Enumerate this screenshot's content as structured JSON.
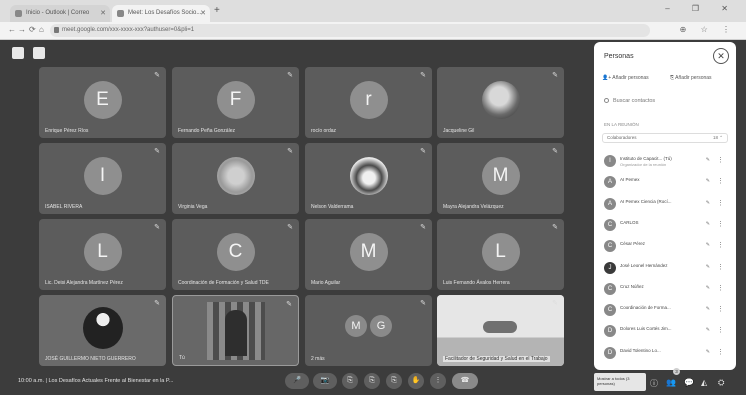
{
  "browser": {
    "tabs": [
      {
        "label": "Inicio - Outlook | Correo"
      },
      {
        "label": "Meet: Los Desafíos Socio..."
      }
    ],
    "new_tab": "+",
    "window_controls": "– ❐ ✕",
    "url": "meet.google.com/xxx-xxxx-xxx?authuser=0&pli=1",
    "nav": {
      "back": "←",
      "forward": "→",
      "reload": "⟳",
      "home": "⌂"
    },
    "addr_icons": "⊕ ☆ ⋮"
  },
  "tiles": [
    {
      "initial": "E",
      "name": "Enrique Pérez Ríos"
    },
    {
      "initial": "F",
      "name": "Fernando Peña González"
    },
    {
      "initial": "r",
      "name": "rocío ordaz"
    },
    {
      "initial": "",
      "name": "Jacqueline Gil",
      "photo": true
    },
    {
      "initial": "I",
      "name": "ISABEL RIVERA"
    },
    {
      "initial": "",
      "name": "Virginia Vega",
      "photo": true
    },
    {
      "initial": "",
      "name": "Nelson Valderrama",
      "photo": true
    },
    {
      "initial": "M",
      "name": "Mayra Alejandra Velázquez"
    },
    {
      "initial": "L",
      "name": "Lic. Deisi Alejandra Martínez Pérez"
    },
    {
      "initial": "C",
      "name": "Coordinación de Formación y Salud TDE"
    },
    {
      "initial": "M",
      "name": "Mario Aguilar"
    },
    {
      "initial": "L",
      "name": "Luis Fernando Ávalos Herrera"
    },
    {
      "initial": "",
      "name": "JOSÉ GUILLERMO NIETO GUERRERO",
      "photo": true
    },
    {
      "initial": "",
      "name": "Tú",
      "photo": true
    },
    {
      "initials": [
        "M",
        "G"
      ],
      "name": "2 más"
    },
    {
      "initial": "",
      "name": "Facilitador de Seguridad y Salud en el Trabajo",
      "photo": true
    }
  ],
  "panel": {
    "title": "Personas",
    "close": "✕",
    "add_people": "Añadir personas",
    "search_placeholder": "Buscar contactos",
    "section_label": "EN LA REUNIÓN",
    "group_label": "Colaboradores",
    "group_count": "18",
    "participants": [
      {
        "initial": "I",
        "name": "Instituto de Capacit... (Tú)",
        "sub": "Organizador de la reunión",
        "dark": false
      },
      {
        "initial": "A",
        "name": "AI Pemex",
        "sub": "",
        "dark": false
      },
      {
        "initial": "A",
        "name": "AI Pemex Ciencia (Rocí...",
        "sub": "",
        "dark": false
      },
      {
        "initial": "C",
        "name": "CARLOS",
        "sub": "",
        "dark": false
      },
      {
        "initial": "C",
        "name": "César Pérez",
        "sub": "",
        "dark": false
      },
      {
        "initial": "J",
        "name": "José Leonel Hernández",
        "sub": "",
        "dark": true
      },
      {
        "initial": "C",
        "name": "Cruz Núñez",
        "sub": "",
        "dark": false
      },
      {
        "initial": "C",
        "name": "Coordinación de Forma...",
        "sub": "",
        "dark": false
      },
      {
        "initial": "D",
        "name": "Dolores Luis Cortés Jim...",
        "sub": "",
        "dark": false
      },
      {
        "initial": "D",
        "name": "David Tolentino Lo...",
        "sub": "",
        "dark": false
      }
    ]
  },
  "meeting": {
    "time": "10:00 a.m.",
    "separator": "|",
    "title": "Los Desafíos Actuales Frente al Bienestar en la P..."
  },
  "controls": [
    "🎤",
    "📷",
    "⎘",
    "✋",
    "⋮",
    "☎"
  ],
  "tooltip": "Mostrar a todos (3 personas)",
  "right_icons": [
    "ⓘ",
    "👥",
    "💬",
    "◭",
    "⛭"
  ],
  "participant_badge": "3"
}
